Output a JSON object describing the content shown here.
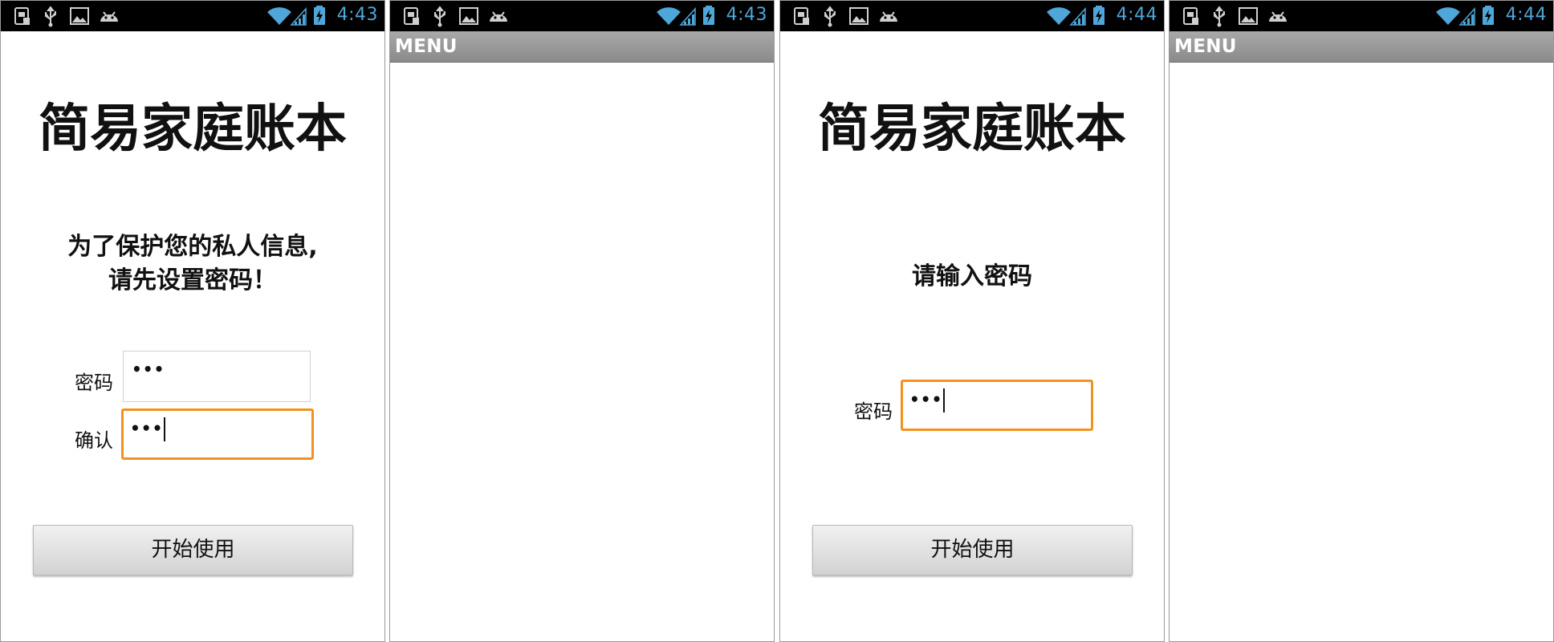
{
  "screens": [
    {
      "status_time": "4:43",
      "app_title": "简易家庭账本",
      "message_line1": "为了保护您的私人信息,",
      "message_line2": "请先设置密码！",
      "password_label": "密码",
      "password_value": "•••",
      "confirm_label": "确认",
      "confirm_value": "•••",
      "start_button_label": "开始使用"
    },
    {
      "status_time": "4:43",
      "menu_label": "MENU"
    },
    {
      "status_time": "4:44",
      "app_title": "简易家庭账本",
      "message": "请输入密码",
      "password_label": "密码",
      "password_value": "•••",
      "start_button_label": "开始使用"
    },
    {
      "status_time": "4:44",
      "menu_label": "MENU"
    }
  ],
  "colors": {
    "focus_accent": "#f2921e",
    "status_text": "#4fa6d8",
    "status_bar": "#000000",
    "menu_bar": "#999999"
  },
  "status_icons": [
    "sim-card-icon",
    "usb-icon",
    "image-icon",
    "android-icon",
    "wifi-icon",
    "signal-icon",
    "battery-charging-icon"
  ]
}
